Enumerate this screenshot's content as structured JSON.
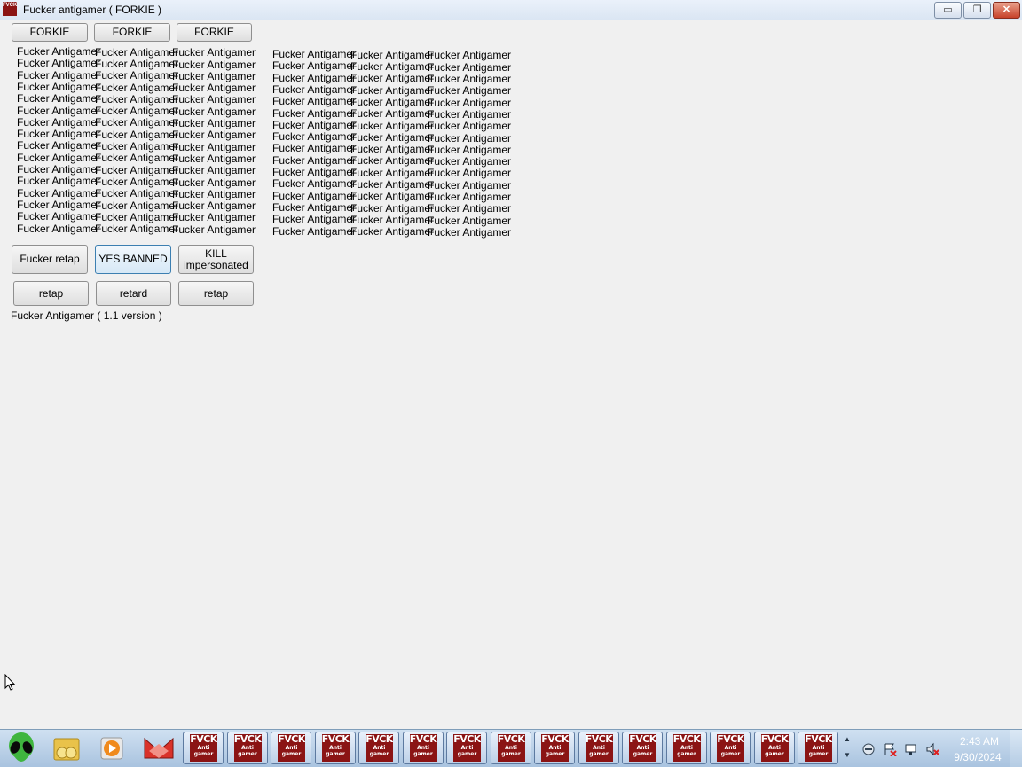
{
  "window": {
    "title": "Fucker antigamer ( FORKIE )",
    "controls": {
      "minimize": "▭",
      "maximize": "❐",
      "close": "✕"
    },
    "icon_text": "FVCK"
  },
  "top_buttons": [
    "FORKIE",
    "FORKIE",
    "FORKIE"
  ],
  "label_text": "Fucker Antigamer",
  "label_grid": {
    "rows": 16,
    "left_columns": 3,
    "right_columns": 3
  },
  "action_buttons_row1": [
    "Fucker retap",
    "YES BANNED",
    "KILL impersonated"
  ],
  "action_buttons_row2": [
    "retap",
    "retard",
    "retap"
  ],
  "version_label": "Fucker Antigamer ( 1.1 version )",
  "taskbar": {
    "app_tile_line1": "FVCK",
    "app_tile_line2": "Anti",
    "app_tile_line3": "gamer",
    "app_tile_count": 15,
    "scroll_up": "▲",
    "scroll_down": "▼",
    "clock_time": "2:43 AM",
    "clock_date": "9/30/2024"
  },
  "colors": {
    "app_red": "#8b1414",
    "window_bg": "#f0f0f0"
  }
}
